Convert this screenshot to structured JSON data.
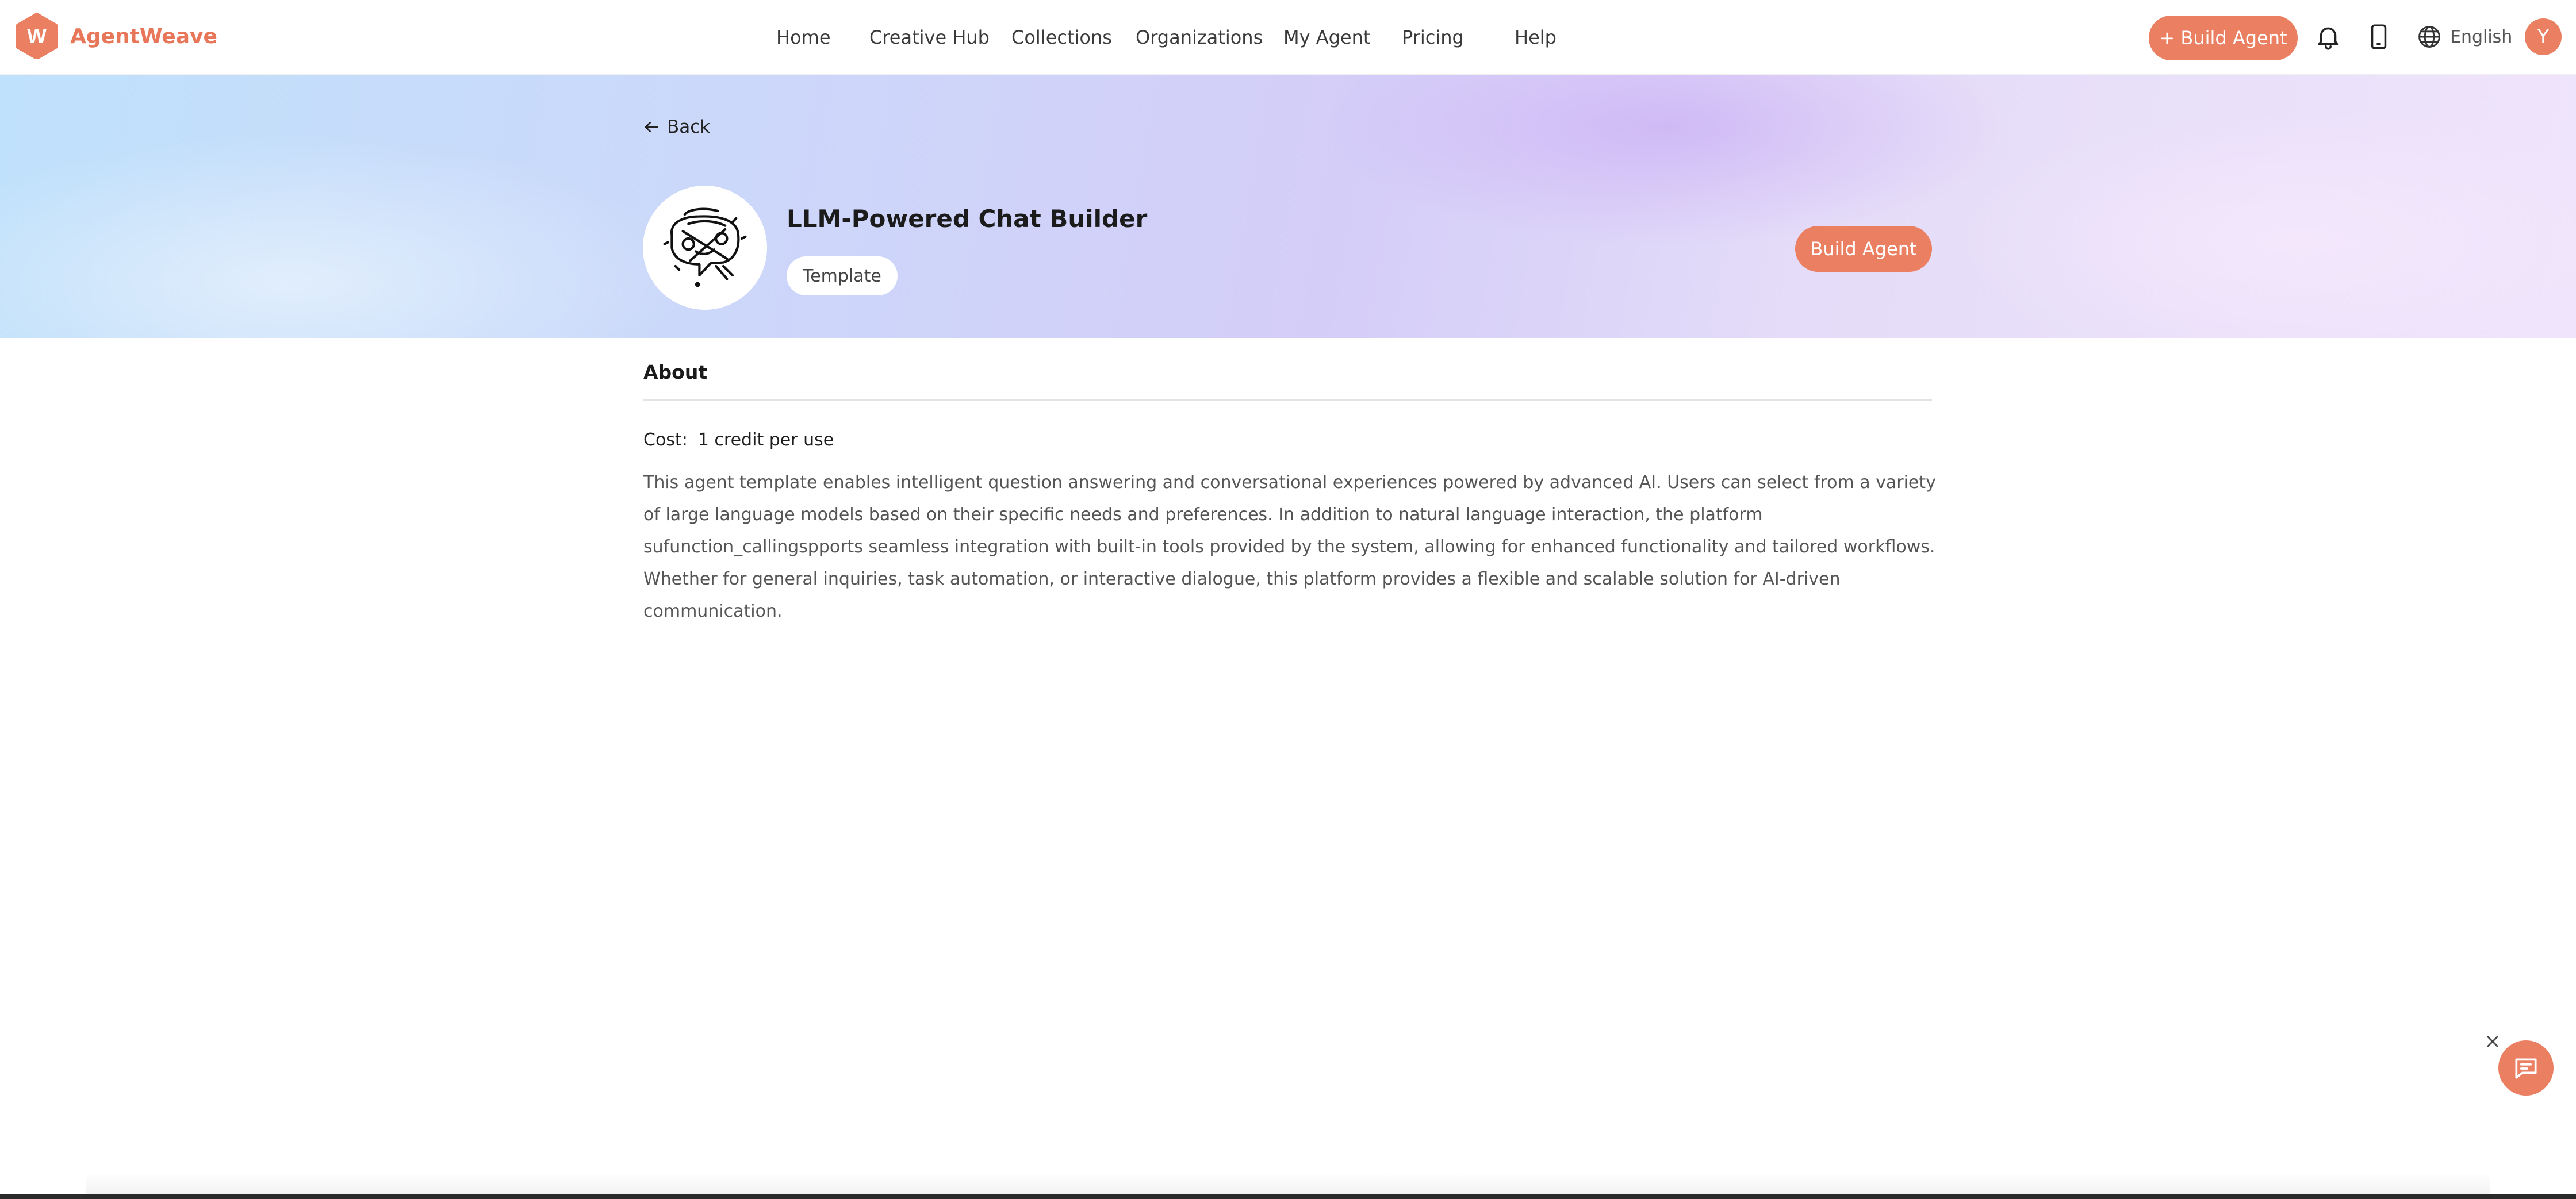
{
  "brand": {
    "name": "AgentWeave",
    "logo_letter": "W",
    "accent": "#ea7f62"
  },
  "nav": {
    "items": [
      {
        "label": "Home"
      },
      {
        "label": "Creative Hub"
      },
      {
        "label": "Collections"
      },
      {
        "label": "Organizations"
      },
      {
        "label": "My Agent"
      },
      {
        "label": "Pricing"
      },
      {
        "label": "Help"
      }
    ],
    "build_button_label": "+ Build Agent",
    "language": "English",
    "user_initial": "Y"
  },
  "hero": {
    "back_label": "Back",
    "title": "LLM-Powered Chat Builder",
    "tag": "Template",
    "build_button_label": "Build Agent"
  },
  "about": {
    "heading": "About",
    "cost_label": "Cost:",
    "cost_value": "1 credit per use",
    "description": "This agent template enables intelligent question answering and conversational experiences powered by advanced AI. Users can select from a variety of large language models based on their specific needs and preferences. In addition to natural language interaction, the platform sufunction_callingspports seamless integration with built-in tools provided by the system, allowing for enhanced functionality and tailored workflows. Whether for general inquiries, task automation, or interactive dialogue, this platform provides a flexible and scalable solution for AI-driven communication."
  },
  "icons": {
    "logo": "hexagon-logo-icon",
    "notifications": "bell-icon",
    "mobile": "mobile-device-icon",
    "language": "globe-icon",
    "back": "arrow-left-icon",
    "chat": "chat-bubble-icon",
    "close": "close-icon"
  }
}
